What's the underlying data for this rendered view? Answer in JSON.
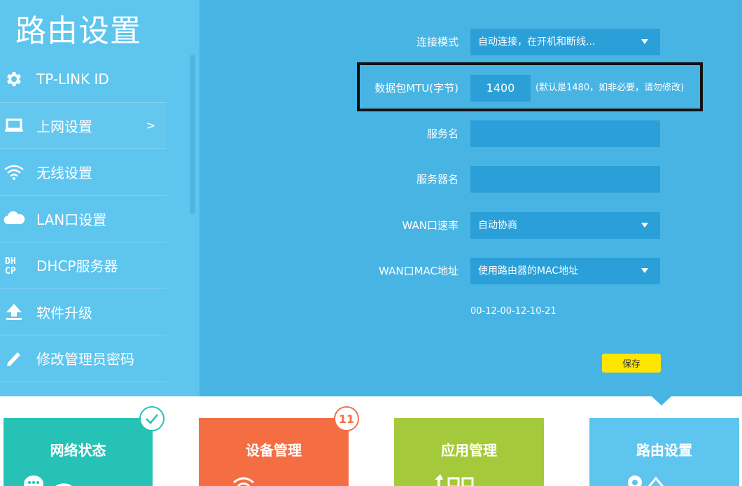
{
  "sidebar": {
    "title": "路由设置",
    "items": [
      {
        "label": "TP-LINK ID",
        "icon": "gear-icon"
      },
      {
        "label": "上网设置",
        "icon": "laptop-icon",
        "arrow": ">"
      },
      {
        "label": "无线设置",
        "icon": "wifi-icon"
      },
      {
        "label": "LAN口设置",
        "icon": "cloud-icon"
      },
      {
        "label": "DHCP服务器",
        "icon": "dhcp-icon",
        "icon_text": "DH CP"
      },
      {
        "label": "软件升级",
        "icon": "upload-icon"
      },
      {
        "label": "修改管理员密码",
        "icon": "pencil-icon"
      }
    ]
  },
  "form": {
    "connection_mode": {
      "label": "连接模式",
      "value": "自动连接，在开机和断线..."
    },
    "mtu": {
      "label": "数据包MTU(字节)",
      "value": "1400",
      "hint": "(默认是1480，如非必要，请勿修改)"
    },
    "service_name": {
      "label": "服务名",
      "value": ""
    },
    "server_name": {
      "label": "服务器名",
      "value": ""
    },
    "wan_speed": {
      "label": "WAN口速率",
      "value": "自动协商"
    },
    "wan_mac": {
      "label": "WAN口MAC地址",
      "value": "使用路由器的MAC地址"
    },
    "mac_address": "00-12-00-12-10-21",
    "save_label": "保存"
  },
  "tiles": [
    {
      "label": "网络状态",
      "color": "#25c2b5"
    },
    {
      "label": "设备管理",
      "color": "#f56e43",
      "badge": "11"
    },
    {
      "label": "应用管理",
      "color": "#a4c93a"
    },
    {
      "label": "路由设置",
      "color": "#5ec5ee"
    }
  ],
  "colors": {
    "sidebar_bg": "#5ec5ee",
    "main_bg": "#48b4e3",
    "field_bg": "#2a9fd8",
    "save_button": "#ffe600"
  }
}
